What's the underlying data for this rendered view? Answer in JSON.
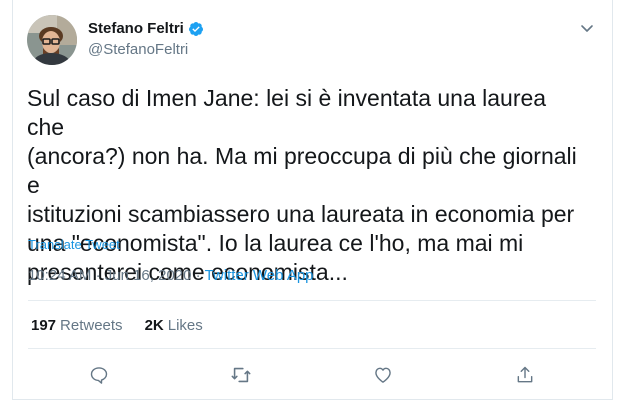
{
  "author": {
    "name": "Stefano Feltri",
    "handle": "@StefanoFeltri",
    "verified": true
  },
  "tweet": {
    "text_lines": [
      "Sul caso di Imen Jane: lei si è inventata una laurea che",
      "(ancora?) non ha. Ma mi preoccupa di più che giornali e",
      "istituzioni scambiassero una laureata in economia per",
      "una \"economista\". Io la laurea ce l'ho, ma mai mi",
      "presenterei come economista..."
    ],
    "translate_label": "Translate Tweet",
    "time": "10:24 AM",
    "date": "Jun 16, 2020",
    "separator": "·",
    "source": "Twitter Web App"
  },
  "stats": {
    "retweets_count": "197",
    "retweets_label": "Retweets",
    "likes_count": "2K",
    "likes_label": "Likes"
  },
  "actions": [
    "reply-icon",
    "retweet-icon",
    "like-icon",
    "share-icon"
  ],
  "colors": {
    "accent": "#1b95e0",
    "muted": "#657786",
    "text": "#14171a",
    "border": "#e6ecf0"
  }
}
